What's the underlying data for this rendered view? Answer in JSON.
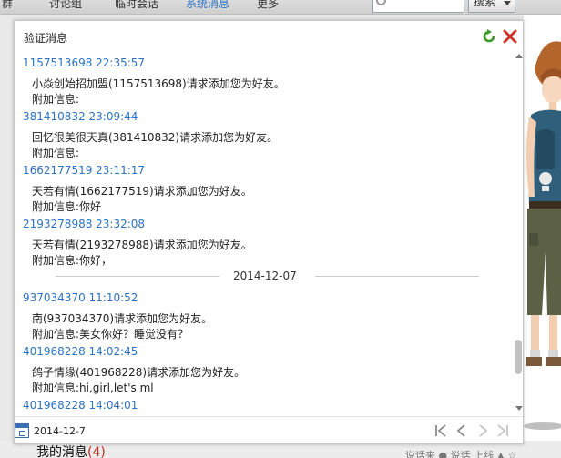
{
  "tabs": [
    {
      "label": "群",
      "active": false
    },
    {
      "label": "讨论组",
      "active": false
    },
    {
      "label": "临时会话",
      "active": false
    },
    {
      "label": "系统消息",
      "active": true
    },
    {
      "label": "更多",
      "active": false
    }
  ],
  "search": {
    "button_label": "搜索",
    "placeholder": ""
  },
  "popup": {
    "title": "验证消息",
    "icons": {
      "refresh": "refresh-icon",
      "close": "close-icon"
    }
  },
  "messages": [
    {
      "head": "1157513698 22:35:57",
      "text": "小焱创始招加盟(1157513698)请求添加您为好友。",
      "extra": "附加信息:"
    },
    {
      "head": "381410832 23:09:44",
      "text": "回忆很美很天真(381410832)请求添加您为好友。",
      "extra": "附加信息:"
    },
    {
      "head": "1662177519 23:11:17",
      "text": "天若有情(1662177519)请求添加您为好友。",
      "extra": "附加信息:你好"
    },
    {
      "head": "2193278988 23:32:08",
      "text": "天若有情(2193278988)请求添加您为好友。",
      "extra": "附加信息:你好，"
    },
    {
      "separator": "2014-12-07"
    },
    {
      "head": "937034370 11:10:52",
      "text": "南(937034370)请求添加您为好友。",
      "extra": "附加信息:美女你好？睡觉没有？"
    },
    {
      "head": "401968228 14:02:45",
      "text": "鸽子情缘(401968228)请求添加您为好友。",
      "extra": "附加信息:hi,girl,let's ml"
    },
    {
      "head": "401968228 14:04:01"
    }
  ],
  "footer": {
    "date": "2014-12-7",
    "nav_icons": [
      "first-page-icon",
      "prev-page-icon",
      "next-page-icon",
      "last-page-icon"
    ]
  },
  "background": {
    "bottom_title": "我的消息",
    "bottom_count": "(4)",
    "bottom_right": "说话来  ● 说话  上线  ▲  ☆"
  },
  "colors": {
    "link_blue": "#2e72c1",
    "active_tab": "#2b74c7",
    "refresh_green": "#3a9a2a",
    "close_red": "#c8382c"
  }
}
